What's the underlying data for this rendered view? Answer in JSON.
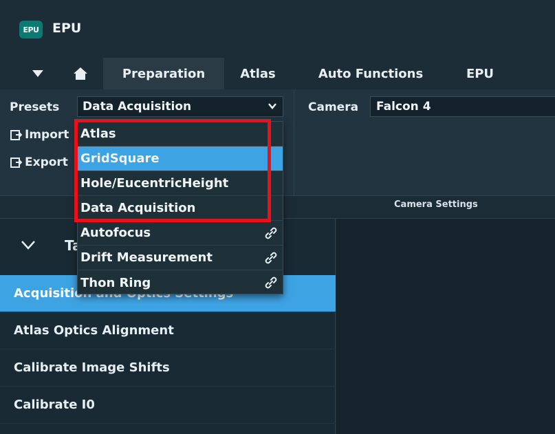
{
  "app": {
    "logo_text": "EPU",
    "title": "EPU"
  },
  "tabs": [
    {
      "label": "Preparation",
      "active": true
    },
    {
      "label": "Atlas",
      "active": false
    },
    {
      "label": "Auto Functions",
      "active": false
    },
    {
      "label": "EPU",
      "active": false
    }
  ],
  "presets": {
    "label": "Presets",
    "selected": "Data Acquisition",
    "import_label": "Import",
    "export_label": "Export"
  },
  "camera": {
    "label": "Camera",
    "value": "Falcon 4"
  },
  "section": {
    "camera_settings": "Camera Settings"
  },
  "tasks": {
    "label": "Tasks",
    "items": [
      {
        "label": "Acquisition and Optics Settings",
        "selected": true
      },
      {
        "label": "Atlas Optics Alignment",
        "selected": false
      },
      {
        "label": "Calibrate Image Shifts",
        "selected": false
      },
      {
        "label": "Calibrate I0",
        "selected": false
      }
    ]
  },
  "preset_dropdown": {
    "options": [
      {
        "label": "Atlas",
        "linked": false,
        "hover": false
      },
      {
        "label": "GridSquare",
        "linked": false,
        "hover": true
      },
      {
        "label": "Hole/EucentricHeight",
        "linked": false,
        "hover": false
      },
      {
        "label": "Data Acquisition",
        "linked": false,
        "hover": false
      },
      {
        "label": "Autofocus",
        "linked": true,
        "hover": false
      },
      {
        "label": "Drift Measurement",
        "linked": true,
        "hover": false
      },
      {
        "label": "Thon Ring",
        "linked": true,
        "hover": false
      }
    ]
  },
  "colors": {
    "accent": "#3ea3e3",
    "highlight_border": "#e8121b",
    "background": "#1b2b35"
  }
}
